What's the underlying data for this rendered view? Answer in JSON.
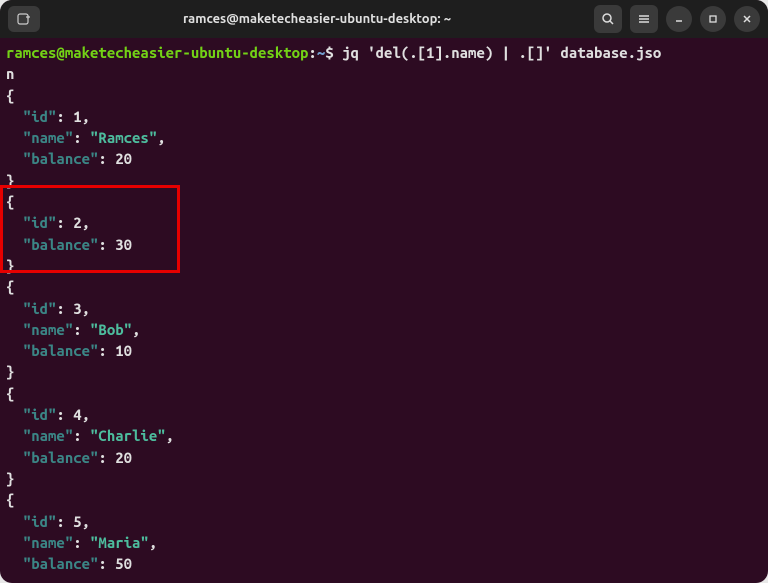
{
  "titlebar": {
    "title": "ramces@maketecheasier-ubuntu-desktop: ~"
  },
  "prompt": {
    "user": "ramces",
    "at": "@",
    "host": "maketecheasier-ubuntu-desktop",
    "colon": ":",
    "path": "~",
    "dollar": "$"
  },
  "command": "jq 'del(.[1].name) | .[]' database.jso",
  "command_wrap": "n",
  "output": {
    "obj1": {
      "open": "{",
      "id_key": "\"id\"",
      "id_val": "1",
      "name_key": "\"name\"",
      "name_val": "\"Ramces\"",
      "bal_key": "\"balance\"",
      "bal_val": "20",
      "close": "}"
    },
    "obj2": {
      "open": "{",
      "id_key": "\"id\"",
      "id_val": "2",
      "bal_key": "\"balance\"",
      "bal_val": "30",
      "close": "}"
    },
    "obj3": {
      "open": "{",
      "id_key": "\"id\"",
      "id_val": "3",
      "name_key": "\"name\"",
      "name_val": "\"Bob\"",
      "bal_key": "\"balance\"",
      "bal_val": "10",
      "close": "}"
    },
    "obj4": {
      "open": "{",
      "id_key": "\"id\"",
      "id_val": "4",
      "name_key": "\"name\"",
      "name_val": "\"Charlie\"",
      "bal_key": "\"balance\"",
      "bal_val": "20",
      "close": "}"
    },
    "obj5": {
      "open": "{",
      "id_key": "\"id\"",
      "id_val": "5",
      "name_key": "\"name\"",
      "name_val": "\"Maria\"",
      "bal_key": "\"balance\"",
      "bal_val": "50"
    }
  },
  "sep": {
    "colon": ": ",
    "comma": ",",
    "indent": "  "
  }
}
